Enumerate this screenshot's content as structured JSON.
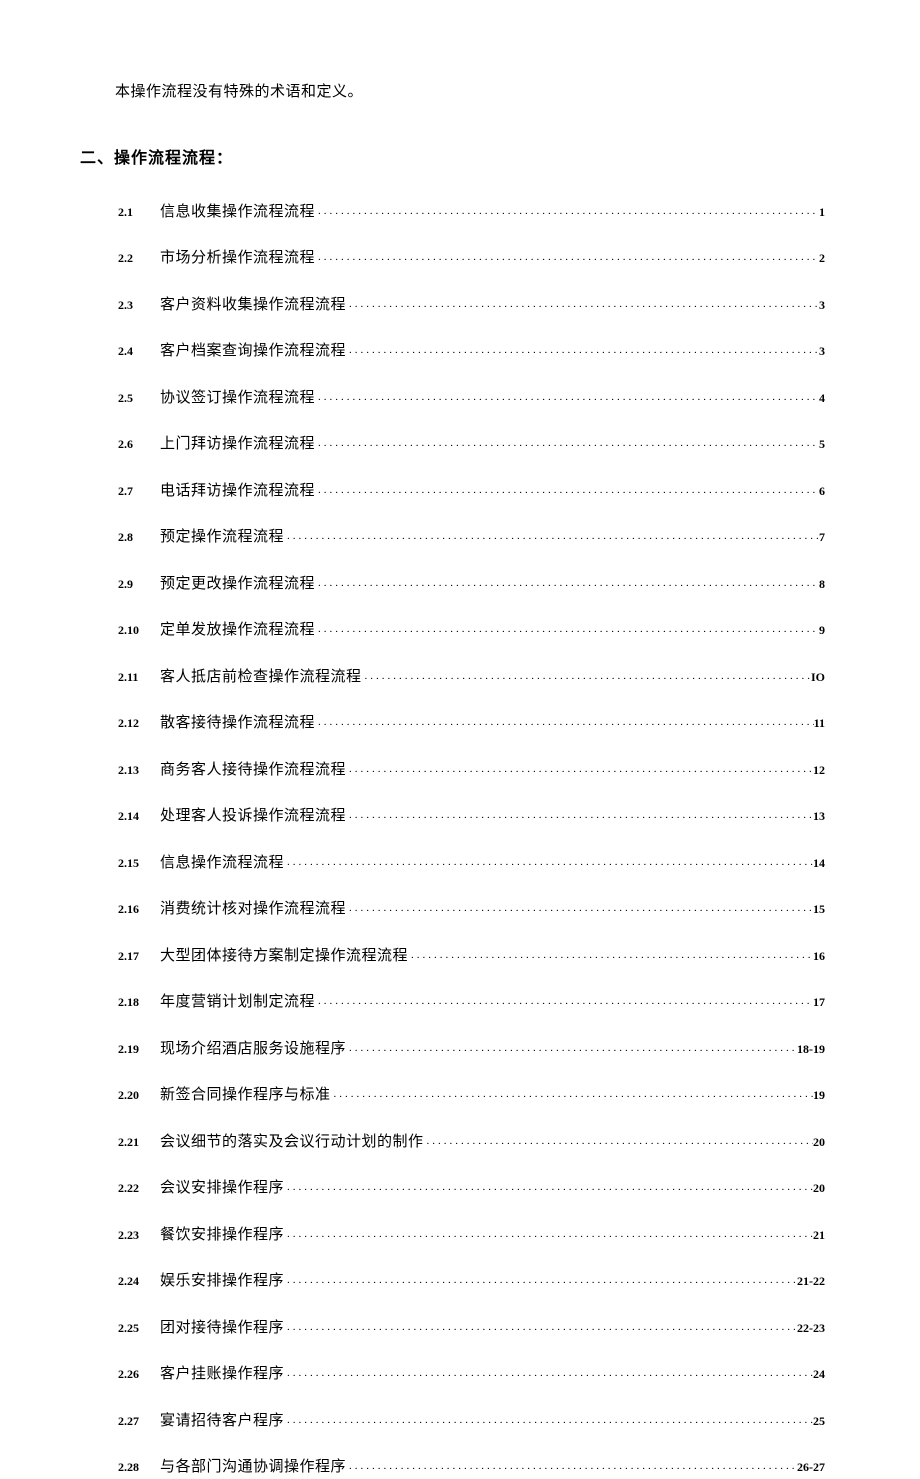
{
  "intro": "本操作流程没有特殊的术语和定义。",
  "heading": "二、操作流程流程：",
  "toc": [
    {
      "num": "2.1",
      "title": "信息收集操作流程流程",
      "page": "1"
    },
    {
      "num": "2.2",
      "title": "市场分析操作流程流程 ",
      "page": "2"
    },
    {
      "num": "2.3",
      "title": "客户资料收集操作流程流程 ",
      "page": "3"
    },
    {
      "num": "2.4",
      "title": "客户档案查询操作流程流程 ",
      "page": "3"
    },
    {
      "num": "2.5",
      "title": "协议签订操作流程流程 ",
      "page": "4"
    },
    {
      "num": "2.6",
      "title": "上门拜访操作流程流程 ",
      "page": "5"
    },
    {
      "num": "2.7",
      "title": "电话拜访操作流程流程 ",
      "page": " 6"
    },
    {
      "num": "2.8",
      "title": "预定操作流程流程 ",
      "page": "7"
    },
    {
      "num": "2.9",
      "title": "预定更改操作流程流程 ",
      "page": "8"
    },
    {
      "num": "2.10",
      "title": "定单发放操作流程流程 ",
      "page": "9"
    },
    {
      "num": "2.11",
      "title": "客人抵店前检查操作流程流程",
      "page": "IO"
    },
    {
      "num": "2.12",
      "title": "散客接待操作流程流程",
      "page": "11"
    },
    {
      "num": "2.13",
      "title": "商务客人接待操作流程流程",
      "page": "12"
    },
    {
      "num": "2.14",
      "title": "处理客人投诉操作流程流程",
      "page": "13"
    },
    {
      "num": "2.15",
      "title": "信息操作流程流程",
      "page": "14"
    },
    {
      "num": "2.16",
      "title": "消费统计核对操作流程流程",
      "page": "15"
    },
    {
      "num": "2.17",
      "title": "大型团体接待方案制定操作流程流程",
      "page": "16"
    },
    {
      "num": "2.18",
      "title": "年度营销计划制定流程",
      "page": "17"
    },
    {
      "num": "2.19",
      "title": "现场介绍酒店服务设施程序",
      "page": " 18-19"
    },
    {
      "num": "2.20",
      "title": "新签合同操作程序与标准",
      "page": "19"
    },
    {
      "num": "2.21",
      "title": "会议细节的落实及会议行动计划的制作",
      "page": "20"
    },
    {
      "num": "2.22",
      "title": "会议安排操作程序",
      "page": "20"
    },
    {
      "num": "2.23",
      "title": "餐饮安排操作程序",
      "page": " 21"
    },
    {
      "num": "2.24",
      "title": "娱乐安排操作程序",
      "page": " 21-22"
    },
    {
      "num": "2.25",
      "title": "团对接待操作程序",
      "page": " 22-23"
    },
    {
      "num": "2.26",
      "title": "客户挂账操作程序",
      "page": " 24"
    },
    {
      "num": "2.27",
      "title": "宴请招待客户程序",
      "page": " 25"
    },
    {
      "num": "2.28",
      "title": "与各部门沟通协调操作程序",
      "page": " 26-27"
    }
  ]
}
